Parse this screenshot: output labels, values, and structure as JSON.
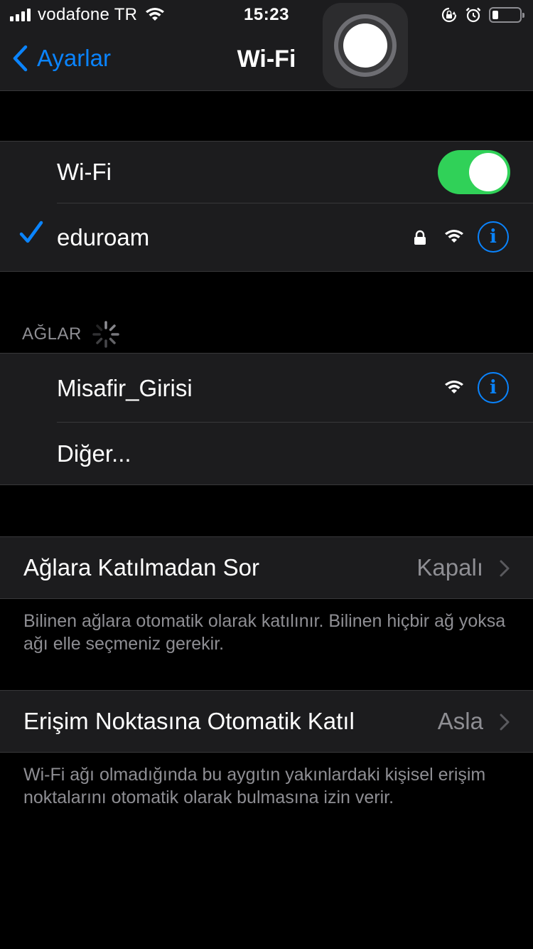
{
  "status_bar": {
    "carrier": "vodafone TR",
    "time": "15:23",
    "icons": [
      "signal-icon",
      "wifi-icon",
      "orientation-lock-icon",
      "alarm-icon",
      "battery-icon"
    ]
  },
  "nav": {
    "back_label": "Ayarlar",
    "title": "Wi-Fi"
  },
  "wifi_section": {
    "toggle_label": "Wi-Fi",
    "toggle_on": true,
    "connected_network": "eduroam"
  },
  "networks_section": {
    "header": "AĞLAR",
    "networks": [
      {
        "name": "Misafir_Girisi"
      }
    ],
    "other_label": "Diğer..."
  },
  "ask_to_join": {
    "label": "Ağlara Katılmadan Sor",
    "value": "Kapalı",
    "footer": "Bilinen ağlara otomatik olarak katılınır. Bilinen hiçbir ağ yoksa ağı elle seçmeniz gerekir."
  },
  "auto_join_hotspot": {
    "label": "Erişim Noktasına Otomatik Katıl",
    "value": "Asla",
    "footer": "Wi-Fi ağı olmadığında bu aygıtın yakınlardaki kişisel erişim noktalarını otomatik olarak bulmasına izin verir."
  },
  "colors": {
    "accent": "#0a84ff",
    "toggle_on": "#30d158",
    "group_bg": "#1c1c1e",
    "secondary_text": "#8e8e93"
  }
}
